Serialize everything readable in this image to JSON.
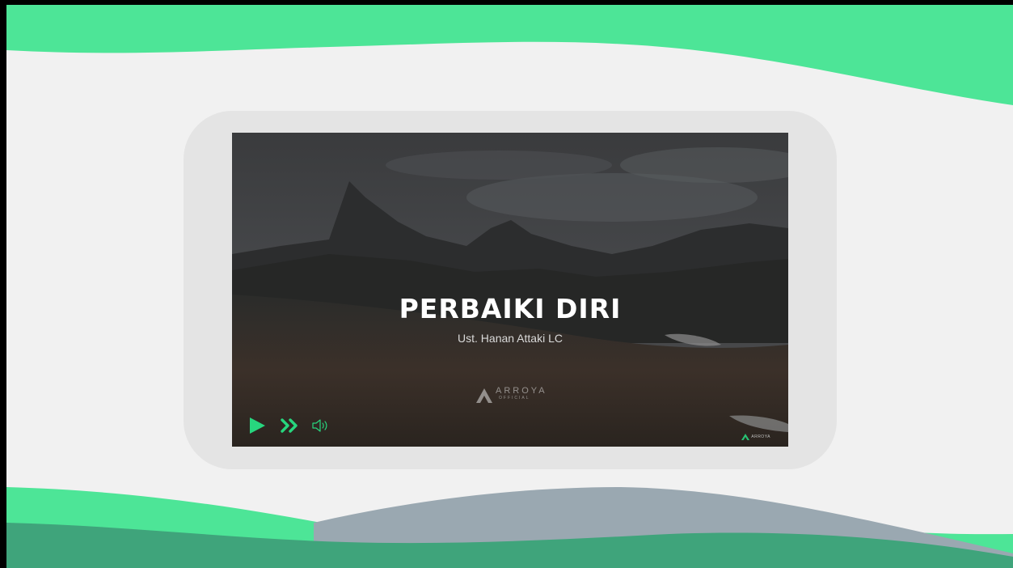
{
  "video": {
    "title": "PERBAIKI DIRI",
    "subtitle": "Ust. Hanan Attaki LC",
    "logo_name": "ARROYA",
    "logo_sub": "OFFICIAL",
    "badge_name": "ARROYA"
  },
  "controls": {
    "play": "play-icon",
    "forward": "fast-forward-icon",
    "volume": "volume-icon"
  },
  "colors": {
    "page_bg": "#f1f1f1",
    "accent_green": "#4de597",
    "dark_green": "#3fa47b",
    "slate_wave": "#9aa8b1",
    "frame": "#e4e4e4"
  }
}
